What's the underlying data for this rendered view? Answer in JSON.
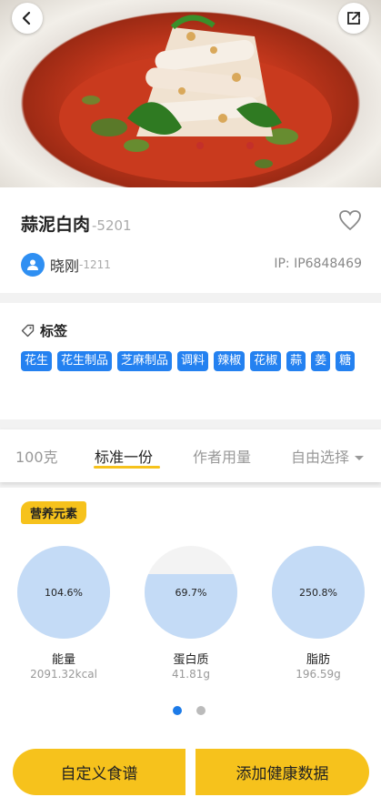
{
  "header": {
    "back_icon": "chevron-left-icon",
    "share_icon": "external-link-icon"
  },
  "recipe": {
    "name": "蒜泥白肉",
    "id": "-5201",
    "author_name": "晓刚",
    "author_id": "-1211",
    "ip": "IP: IP6848469"
  },
  "tags": {
    "title": "标签",
    "items": [
      "花生",
      "花生制品",
      "芝麻制品",
      "调料",
      "辣椒",
      "花椒",
      "蒜",
      "姜",
      "糖"
    ]
  },
  "tabs": {
    "items": [
      "100克",
      "标准一份",
      "作者用量",
      "自由选择"
    ],
    "active": "标准一份"
  },
  "nutrition": {
    "badge": "营养元素",
    "items": [
      {
        "name": "能量",
        "percent": "104.6%",
        "value": "2091.32kcal",
        "fill": 1.0
      },
      {
        "name": "蛋白质",
        "percent": "69.7%",
        "value": "41.81g",
        "fill": 0.697
      },
      {
        "name": "脂肪",
        "percent": "250.8%",
        "value": "196.59g",
        "fill": 1.0
      }
    ],
    "page_index": 0,
    "page_count": 2
  },
  "actions": {
    "custom_recipe": "自定义食谱",
    "add_health_data": "添加健康数据"
  },
  "colors": {
    "accent": "#f6c21c",
    "tag_blue": "#2481f0",
    "gauge_fill": "#c4dbf6"
  }
}
